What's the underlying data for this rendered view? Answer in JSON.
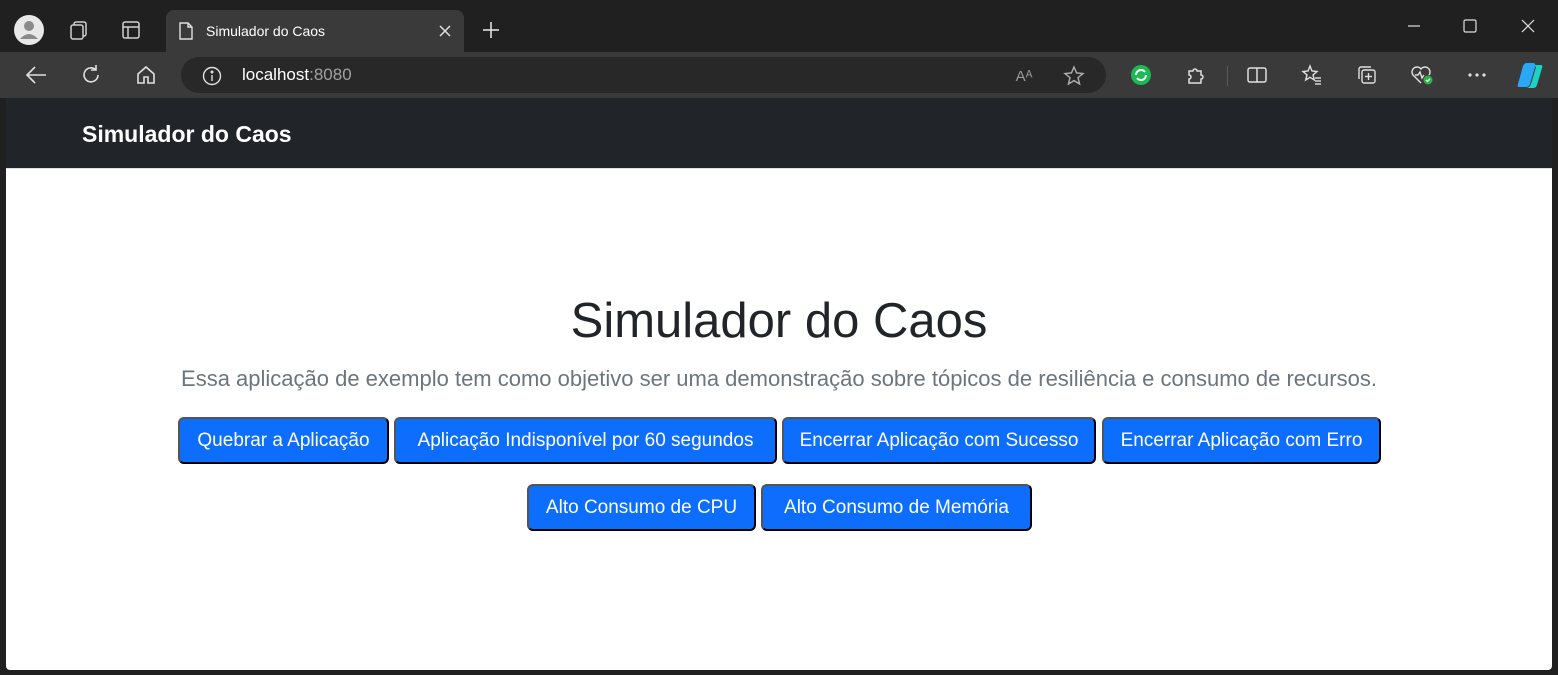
{
  "browser": {
    "tab_title": "Simulador do Caos",
    "url_host": "localhost",
    "url_port": ":8080",
    "read_aloud_glyph": "Aᴬ"
  },
  "page": {
    "brand": "Simulador do Caos",
    "title": "Simulador do Caos",
    "lead": "Essa aplicação de exemplo tem como objetivo ser uma demonstração sobre tópicos de resiliência e consumo de recursos.",
    "buttons": [
      "Quebrar a Aplicação",
      "Aplicação Indisponível por 60 segundos",
      "Encerrar Aplicação com Sucesso",
      "Encerrar Aplicação com Erro",
      "Alto Consumo de CPU",
      "Alto Consumo de Memória"
    ]
  },
  "colors": {
    "primary_button": "#0d6efd",
    "navbar": "#212529",
    "browser_chrome": "#202020"
  },
  "icons": [
    "profile-icon",
    "workspaces-icon",
    "tab-actions-icon",
    "page-icon",
    "close-icon",
    "plus-icon",
    "back-icon",
    "reload-icon",
    "home-icon",
    "info-icon",
    "star-icon",
    "extension-icon",
    "puzzle-icon",
    "split-screen-icon",
    "favorites-icon",
    "collections-icon",
    "health-icon",
    "more-icon",
    "copilot-icon"
  ]
}
